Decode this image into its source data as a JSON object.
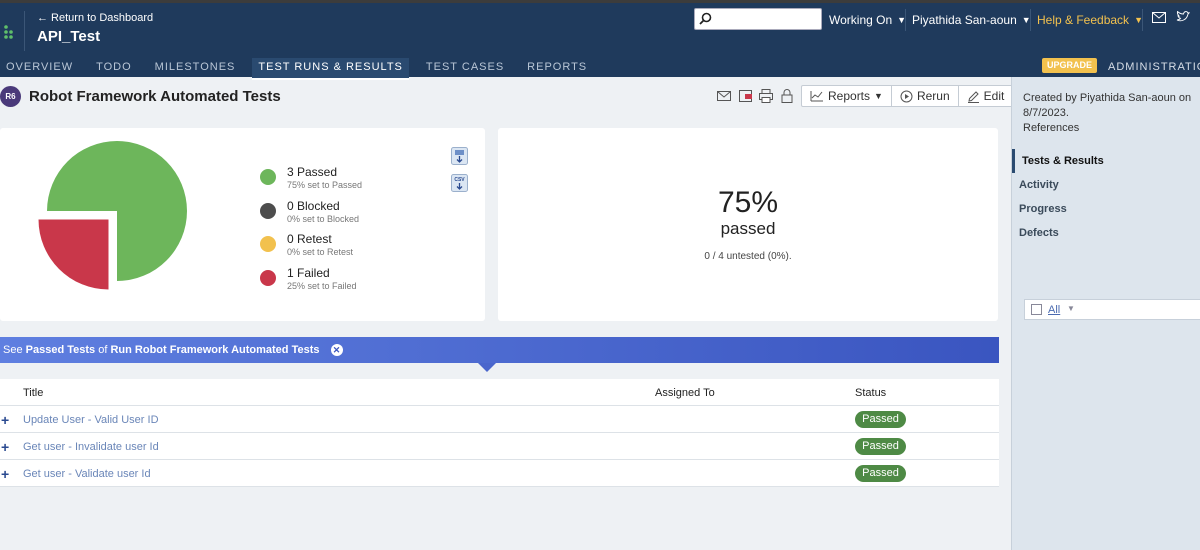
{
  "header": {
    "back_link": "← Return to Dashboard",
    "project_title": "API_Test",
    "search_placeholder": "",
    "working_on": "Working On",
    "user_name": "Piyathida San-aoun",
    "help": "Help & Feedback",
    "upgrade": "UPGRADE",
    "administration": "ADMINISTRATION",
    "colors": {
      "bar": "#1f3a5c",
      "accent": "#f2c14e"
    }
  },
  "tabs": [
    {
      "label": "OVERVIEW"
    },
    {
      "label": "TODO"
    },
    {
      "label": "MILESTONES"
    },
    {
      "label": "TEST RUNS & RESULTS",
      "active": true
    },
    {
      "label": "TEST CASES"
    },
    {
      "label": "REPORTS"
    }
  ],
  "run": {
    "id_badge": "R6",
    "title": "Robot Framework Automated Tests",
    "toolbar": {
      "icons": [
        "email-icon",
        "export-icon",
        "print-icon",
        "lock-icon"
      ],
      "reports": "Reports",
      "rerun": "Rerun",
      "edit": "Edit"
    }
  },
  "chart_data": {
    "type": "pie",
    "categories": [
      "Passed",
      "Blocked",
      "Retest",
      "Failed"
    ],
    "values": [
      3,
      0,
      0,
      1
    ],
    "colors": [
      "#6db65b",
      "#4d4d4d",
      "#f2c14e",
      "#c9374a"
    ]
  },
  "legend": [
    {
      "label": "3 Passed",
      "sub": "75% set to Passed",
      "color": "#6db65b"
    },
    {
      "label": "0 Blocked",
      "sub": "0% set to Blocked",
      "color": "#4d4d4d"
    },
    {
      "label": "0 Retest",
      "sub": "0% set to Retest",
      "color": "#f2c14e"
    },
    {
      "label": "1 Failed",
      "sub": "25% set to Failed",
      "color": "#c9374a"
    }
  ],
  "summary": {
    "percent": "75%",
    "word": "passed",
    "untested": "0 / 4 untested (0%)."
  },
  "filter": {
    "prefix": "See",
    "status": "Passed Tests",
    "middle": "of",
    "run": "Run Robot Framework Automated Tests"
  },
  "table": {
    "columns": [
      "Title",
      "Assigned To",
      "Status"
    ],
    "rows": [
      {
        "title": "Update User - Valid User ID",
        "assigned": "",
        "status": "Passed"
      },
      {
        "title": "Get user - Invalidate user Id",
        "assigned": "",
        "status": "Passed"
      },
      {
        "title": "Get user - Validate user Id",
        "assigned": "",
        "status": "Passed"
      }
    ]
  },
  "sidebar": {
    "created_by": "Created by Piyathida San-aoun on 8/7/2023.",
    "references": "References",
    "nav": [
      {
        "label": "Tests & Results",
        "active": true
      },
      {
        "label": "Activity"
      },
      {
        "label": "Progress"
      },
      {
        "label": "Defects"
      }
    ],
    "filter_all": "All"
  }
}
